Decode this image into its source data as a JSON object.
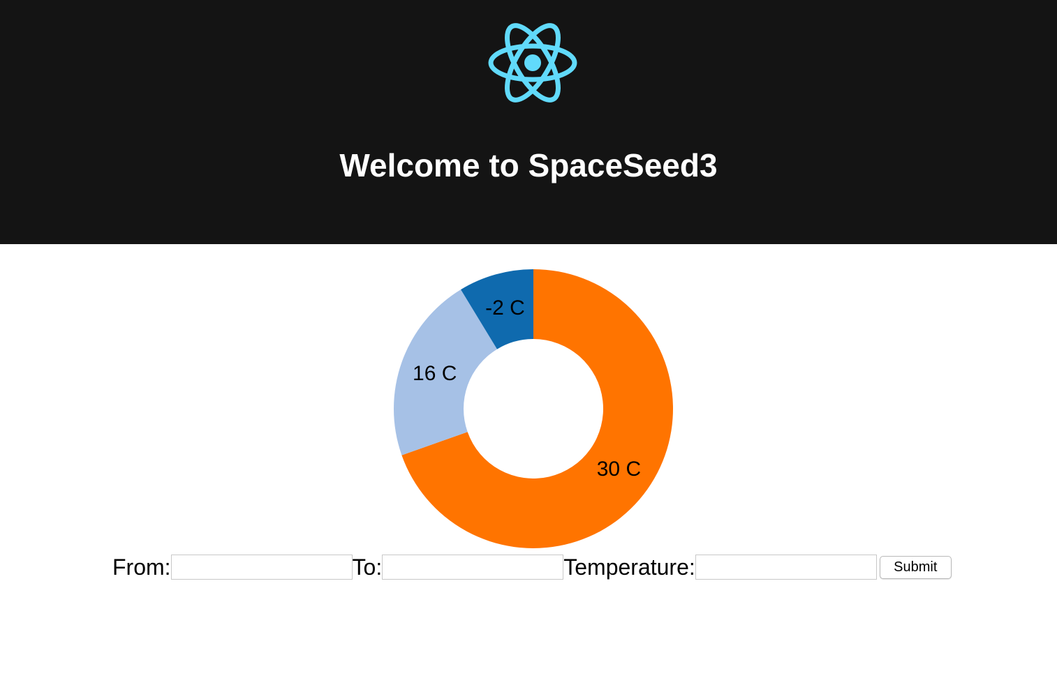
{
  "header": {
    "logo_icon": "react-atom-logo-icon",
    "title": "Welcome to SpaceSeed3",
    "background_color": "#141414",
    "logo_color": "#61dafb"
  },
  "chart_data": {
    "type": "pie",
    "donut": true,
    "slices": [
      {
        "value": 30,
        "label": "30 C",
        "color": "#ff7400"
      },
      {
        "value": 16,
        "label": "16 C",
        "color": "#a6c1e6"
      },
      {
        "value": -2,
        "label": "-2 C",
        "color": "#0f6aae"
      }
    ],
    "slice_fractions": [
      0.696,
      0.217,
      0.087
    ]
  },
  "form": {
    "from_label": "From:",
    "to_label": "To:",
    "temperature_label": "Temperature:",
    "from_value": "",
    "to_value": "",
    "temperature_value": "",
    "submit_label": "Submit"
  }
}
